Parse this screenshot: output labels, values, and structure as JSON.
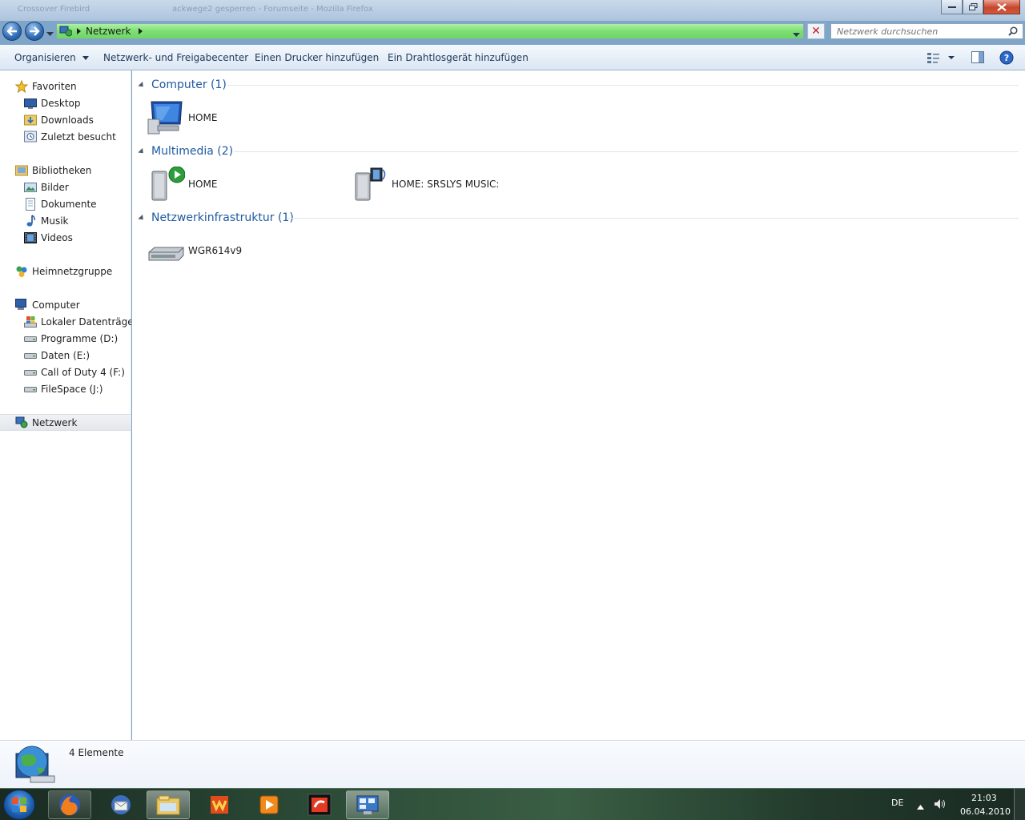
{
  "window": {
    "ghost_title_left": "Crossover Firebird",
    "ghost_title_right": "ackwege2 gesperren - Forumseite - Mozilla Firefox"
  },
  "navbar": {
    "breadcrumb": "Netzwerk",
    "search_placeholder": "Netzwerk durchsuchen",
    "address_color": "#7ede73"
  },
  "toolbar": {
    "organize": "Organisieren",
    "network_center": "Netzwerk- und Freigabecenter",
    "add_printer": "Einen Drucker hinzufügen",
    "add_wireless": "Ein Drahtlosgerät hinzufügen"
  },
  "sidebar": {
    "favorites": {
      "label": "Favoriten",
      "items": [
        "Desktop",
        "Downloads",
        "Zuletzt besucht"
      ]
    },
    "libraries": {
      "label": "Bibliotheken",
      "items": [
        "Bilder",
        "Dokumente",
        "Musik",
        "Videos"
      ]
    },
    "homegroup": "Heimnetzgruppe",
    "computer": {
      "label": "Computer",
      "items": [
        "Lokaler Datenträger (C:)",
        "Programme (D:)",
        "Daten (E:)",
        "Call of Duty 4 (F:)",
        "FileSpace (J:)"
      ]
    },
    "network": "Netzwerk"
  },
  "groups": [
    {
      "title": "Computer (1)",
      "items": [
        "HOME"
      ]
    },
    {
      "title": "Multimedia (2)",
      "items": [
        "HOME",
        "HOME: SRSLYS MUSIC:"
      ]
    },
    {
      "title": "Netzwerkinfrastruktur (1)",
      "items": [
        "WGR614v9"
      ]
    }
  ],
  "details": {
    "count": "4 Elemente"
  },
  "taskbar": {
    "apps": [
      "firefox-icon",
      "thunderbird-icon",
      "explorer-icon",
      "winamp-icon",
      "media-player-icon",
      "foobar-icon",
      "control-panel-icon"
    ],
    "language": "DE",
    "time": "21:03",
    "date": "06.04.2010"
  }
}
